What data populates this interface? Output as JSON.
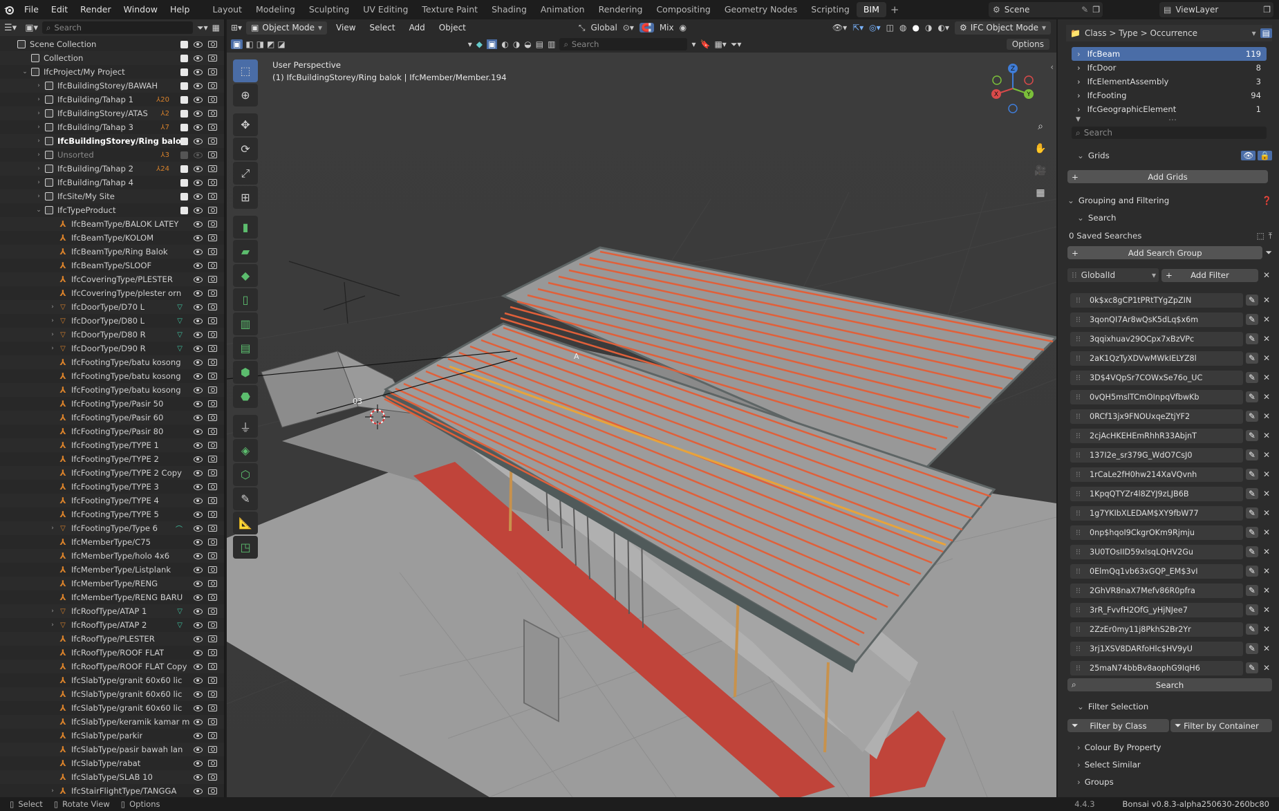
{
  "menu": {
    "items": [
      "File",
      "Edit",
      "Render",
      "Window",
      "Help"
    ]
  },
  "workspace_tabs": [
    "Layout",
    "Modeling",
    "Sculpting",
    "UV Editing",
    "Texture Paint",
    "Shading",
    "Animation",
    "Rendering",
    "Compositing",
    "Geometry Nodes",
    "Scripting",
    "BIM"
  ],
  "active_tab": "BIM",
  "scene": {
    "name": "Scene",
    "view_layer": "ViewLayer"
  },
  "outliner": {
    "search_placeholder": "Search",
    "rows": [
      {
        "label": "Scene Collection",
        "indent": 0,
        "icon": "collection",
        "arrow": "",
        "badge": ""
      },
      {
        "label": "Collection",
        "indent": 1,
        "icon": "collection",
        "arrow": "",
        "badge": ""
      },
      {
        "label": "IfcProject/My Project",
        "indent": 1,
        "icon": "collection",
        "arrow": "v",
        "badge": ""
      },
      {
        "label": "IfcBuildingStorey/BAWAH",
        "indent": 2,
        "icon": "collection",
        "arrow": ">",
        "badge": ""
      },
      {
        "label": "IfcBuilding/Tahap 1",
        "indent": 2,
        "icon": "collection",
        "arrow": ">",
        "badge": "20"
      },
      {
        "label": "IfcBuildingStorey/ATAS",
        "indent": 2,
        "icon": "collection",
        "arrow": ">",
        "badge": "2"
      },
      {
        "label": "IfcBuilding/Tahap 3",
        "indent": 2,
        "icon": "collection",
        "arrow": ">",
        "badge": "7"
      },
      {
        "label": "IfcBuildingStorey/Ring balok",
        "indent": 2,
        "icon": "collection",
        "arrow": ">",
        "badge": "",
        "bold": true
      },
      {
        "label": "Unsorted",
        "indent": 2,
        "icon": "collection",
        "arrow": ">",
        "badge": "3",
        "dim": true
      },
      {
        "label": "IfcBuilding/Tahap 2",
        "indent": 2,
        "icon": "collection",
        "arrow": ">",
        "badge": "24"
      },
      {
        "label": "IfcBuilding/Tahap 4",
        "indent": 2,
        "icon": "collection",
        "arrow": ">",
        "badge": ""
      },
      {
        "label": "IfcSite/My Site",
        "indent": 2,
        "icon": "collection",
        "arrow": ">",
        "badge": ""
      },
      {
        "label": "IfcTypeProduct",
        "indent": 2,
        "icon": "collection",
        "arrow": "v",
        "badge": ""
      },
      {
        "label": "IfcBeamType/BALOK LATEY",
        "indent": 3,
        "icon": "type",
        "arrow": "",
        "badge": ""
      },
      {
        "label": "IfcBeamType/KOLOM",
        "indent": 3,
        "icon": "type",
        "arrow": "",
        "badge": ""
      },
      {
        "label": "IfcBeamType/Ring Balok",
        "indent": 3,
        "icon": "type",
        "arrow": "",
        "badge": ""
      },
      {
        "label": "IfcBeamType/SLOOF",
        "indent": 3,
        "icon": "type",
        "arrow": "",
        "badge": ""
      },
      {
        "label": "IfcCoveringType/PLESTER",
        "indent": 3,
        "icon": "type",
        "arrow": "",
        "badge": ""
      },
      {
        "label": "IfcCoveringType/plester orn",
        "indent": 3,
        "icon": "type",
        "arrow": "",
        "badge": ""
      },
      {
        "label": "IfcDoorType/D70 L",
        "indent": 3,
        "icon": "tri",
        "arrow": ">",
        "badge": "m"
      },
      {
        "label": "IfcDoorType/D80 L",
        "indent": 3,
        "icon": "tri",
        "arrow": ">",
        "badge": "m"
      },
      {
        "label": "IfcDoorType/D80 R",
        "indent": 3,
        "icon": "tri",
        "arrow": ">",
        "badge": "m"
      },
      {
        "label": "IfcDoorType/D90 R",
        "indent": 3,
        "icon": "tri",
        "arrow": ">",
        "badge": "m"
      },
      {
        "label": "IfcFootingType/batu kosong",
        "indent": 3,
        "icon": "type",
        "arrow": "",
        "badge": ""
      },
      {
        "label": "IfcFootingType/batu kosong",
        "indent": 3,
        "icon": "type",
        "arrow": "",
        "badge": ""
      },
      {
        "label": "IfcFootingType/batu kosong",
        "indent": 3,
        "icon": "type",
        "arrow": "",
        "badge": ""
      },
      {
        "label": "IfcFootingType/Pasir 50",
        "indent": 3,
        "icon": "type",
        "arrow": "",
        "badge": ""
      },
      {
        "label": "IfcFootingType/Pasir 60",
        "indent": 3,
        "icon": "type",
        "arrow": "",
        "badge": ""
      },
      {
        "label": "IfcFootingType/Pasir 80",
        "indent": 3,
        "icon": "type",
        "arrow": "",
        "badge": ""
      },
      {
        "label": "IfcFootingType/TYPE 1",
        "indent": 3,
        "icon": "type",
        "arrow": "",
        "badge": ""
      },
      {
        "label": "IfcFootingType/TYPE 2",
        "indent": 3,
        "icon": "type",
        "arrow": "",
        "badge": ""
      },
      {
        "label": "IfcFootingType/TYPE 2 Copy",
        "indent": 3,
        "icon": "type",
        "arrow": "",
        "badge": ""
      },
      {
        "label": "IfcFootingType/TYPE 3",
        "indent": 3,
        "icon": "type",
        "arrow": "",
        "badge": ""
      },
      {
        "label": "IfcFootingType/TYPE 4",
        "indent": 3,
        "icon": "type",
        "arrow": "",
        "badge": ""
      },
      {
        "label": "IfcFootingType/TYPE 5",
        "indent": 3,
        "icon": "type",
        "arrow": "",
        "badge": ""
      },
      {
        "label": "IfcFootingType/Type 6",
        "indent": 3,
        "icon": "tri",
        "arrow": ">",
        "badge": "c"
      },
      {
        "label": "IfcMemberType/C75",
        "indent": 3,
        "icon": "type",
        "arrow": "",
        "badge": ""
      },
      {
        "label": "IfcMemberType/holo 4x6",
        "indent": 3,
        "icon": "type",
        "arrow": "",
        "badge": ""
      },
      {
        "label": "IfcMemberType/Listplank",
        "indent": 3,
        "icon": "type",
        "arrow": "",
        "badge": ""
      },
      {
        "label": "IfcMemberType/RENG",
        "indent": 3,
        "icon": "type",
        "arrow": "",
        "badge": ""
      },
      {
        "label": "IfcMemberType/RENG BARU",
        "indent": 3,
        "icon": "type",
        "arrow": "",
        "badge": ""
      },
      {
        "label": "IfcRoofType/ATAP 1",
        "indent": 3,
        "icon": "tri",
        "arrow": ">",
        "badge": "m"
      },
      {
        "label": "IfcRoofType/ATAP 2",
        "indent": 3,
        "icon": "tri",
        "arrow": ">",
        "badge": "m"
      },
      {
        "label": "IfcRoofType/PLESTER",
        "indent": 3,
        "icon": "type",
        "arrow": "",
        "badge": ""
      },
      {
        "label": "IfcRoofType/ROOF FLAT",
        "indent": 3,
        "icon": "type",
        "arrow": "",
        "badge": ""
      },
      {
        "label": "IfcRoofType/ROOF FLAT Copy",
        "indent": 3,
        "icon": "type",
        "arrow": "",
        "badge": ""
      },
      {
        "label": "IfcSlabType/granit 60x60 lic",
        "indent": 3,
        "icon": "type",
        "arrow": "",
        "badge": ""
      },
      {
        "label": "IfcSlabType/granit 60x60 lic",
        "indent": 3,
        "icon": "type",
        "arrow": "",
        "badge": ""
      },
      {
        "label": "IfcSlabType/granit 60x60 lic",
        "indent": 3,
        "icon": "type",
        "arrow": "",
        "badge": ""
      },
      {
        "label": "IfcSlabType/keramik kamar m",
        "indent": 3,
        "icon": "type",
        "arrow": "",
        "badge": ""
      },
      {
        "label": "IfcSlabType/parkir",
        "indent": 3,
        "icon": "type",
        "arrow": "",
        "badge": ""
      },
      {
        "label": "IfcSlabType/pasir bawah lan",
        "indent": 3,
        "icon": "type",
        "arrow": "",
        "badge": ""
      },
      {
        "label": "IfcSlabType/rabat",
        "indent": 3,
        "icon": "type",
        "arrow": "",
        "badge": ""
      },
      {
        "label": "IfcSlabType/SLAB 10",
        "indent": 3,
        "icon": "type",
        "arrow": "",
        "badge": ""
      },
      {
        "label": "IfcStairFlightType/TANGGA",
        "indent": 3,
        "icon": "type",
        "arrow": ">",
        "badge": ""
      }
    ]
  },
  "viewport": {
    "mode": "Object Mode",
    "menus": [
      "View",
      "Select",
      "Add",
      "Object"
    ],
    "orientation": "Global",
    "snap_mode": "Mix",
    "ifc_mode": "IFC Object Mode",
    "search_placeholder": "Search",
    "options_label": "Options",
    "info_line1": "User Perspective",
    "info_line2": "(1) IfcBuildingStorey/Ring balok | IfcMember/Member.194",
    "label_03": "03",
    "label_A": "A",
    "axes": {
      "x": "X",
      "y": "Y",
      "z": "Z"
    }
  },
  "rpanel": {
    "class_tree_title": "Class > Type > Occurrence",
    "classes": [
      {
        "name": "IfcBeam",
        "count": "119",
        "selected": true
      },
      {
        "name": "IfcDoor",
        "count": "8"
      },
      {
        "name": "IfcElementAssembly",
        "count": "3"
      },
      {
        "name": "IfcFooting",
        "count": "94"
      },
      {
        "name": "IfcGeographicElement",
        "count": "1"
      }
    ],
    "search_placeholder": "Search",
    "grids_label": "Grids",
    "add_grids": "Add Grids",
    "grouping_label": "Grouping and Filtering",
    "search_label": "Search",
    "saved_searches": "0 Saved Searches",
    "add_search_group": "Add Search Group",
    "filter_field": "GlobalId",
    "add_filter": "Add Filter",
    "guids": [
      "0k$xc8gCP1tPRtTYgZpZIN",
      "3qonQI7Ar8wQsK5dLq$x6m",
      "3qqixhuav29OCpx7xBzVPc",
      "2aK1QzTyXDVwMWkIELYZ8l",
      "3D$4VQpSr7COWxSe76o_UC",
      "0vQH5mslTCmOInpqVfbwKb",
      "0RCf13jx9FNOUxqeZtjYF2",
      "2cjAcHKEHEmRhhR33AbjnT",
      "137I2e_sr379G_WdO7CsJ0",
      "1rCaLe2fH0hw214XaVQvnh",
      "1KpqQTYZr4l8ZYJ9zLJB6B",
      "1g7YKIbXLEDAM$XY9fbW77",
      "0np$hqoI9CkgrOKm9Rjmju",
      "3U0TOsIID59xlsqLQHV2Gu",
      "0ElmQq1vb63xGQP_EM$3vI",
      "2GhVR8naX7Mefv86R0pfra",
      "3rR_FvvfH2OfG_yHjNJee7",
      "2ZzEr0my11j8PkhS2Br2Yr",
      "3rj1XSV8DARfoHlc$HV9yU",
      "25maN74bbBv8aophG9IqH6"
    ],
    "search_button": "Search",
    "filter_selection": "Filter Selection",
    "filter_by_class": "Filter by Class",
    "filter_by_container": "Filter by Container",
    "colour_by_property": "Colour By Property",
    "select_similar": "Select Similar",
    "groups": "Groups"
  },
  "status": {
    "select": "Select",
    "rotate_view": "Rotate View",
    "options": "Options",
    "version": "4.4.3",
    "addon": "Bonsai v0.8.3-alpha250630-260bc80"
  },
  "colors": {
    "accent": "#4a6da7",
    "roof_line": "#e0603a",
    "selected_beam": "#e8a33b",
    "floor_red": "#c0443a"
  }
}
